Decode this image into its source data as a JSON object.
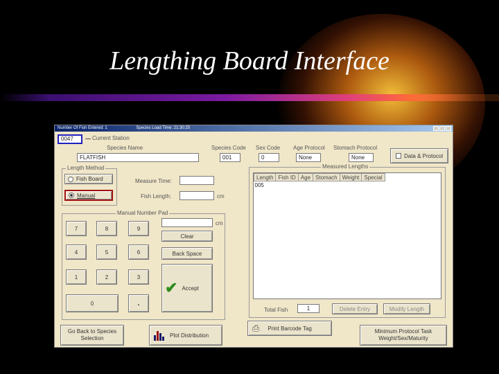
{
  "slide": {
    "title": "Lengthing Board Interface"
  },
  "window": {
    "title": "Number Of Fish Entered: 1",
    "load_time": "Species Load Time: 21:30:25"
  },
  "station": {
    "value": "0047",
    "label": "Current Station"
  },
  "species": {
    "name_label": "Species Name",
    "name_value": "FLATFISH",
    "code_label": "Species Code",
    "code_value": "001",
    "sex_label": "Sex Code",
    "sex_value": "0",
    "age_label": "Age Protocol",
    "age_value": "None",
    "stomach_label": "Stomach Protocol",
    "stomach_value": "None",
    "protocol_button": "Data & Protocol"
  },
  "length_method": {
    "group_label": "Length Method",
    "fish_board": "Fish Board",
    "manual": "Manual",
    "selected": "Manual",
    "measure_time_label": "Measure Time:",
    "fish_length_label": "Fish Length:",
    "unit": "cm"
  },
  "number_pad": {
    "group_label": "Manual Number Pad",
    "unit": "cm",
    "keys": [
      "7",
      "8",
      "9",
      "4",
      "5",
      "6",
      "1",
      "2",
      "3",
      "0",
      "."
    ],
    "clear": "Clear",
    "backspace": "Back Space",
    "accept": "Accept"
  },
  "lengths": {
    "group_label": "Measured Lengths",
    "columns": [
      "Length",
      "Fish ID",
      "Age",
      "Stomach",
      "Weight",
      "Special"
    ],
    "rows": [
      [
        "005"
      ]
    ],
    "total_label": "Total Fish",
    "total_value": "1",
    "delete_button": "Delete Entry",
    "modify_button": "Modify Length"
  },
  "bottom": {
    "back_button": "Go Back to Species Selection",
    "plot_button": "Plot Distribution",
    "print_button": "Print Barcode Tag",
    "minimum_button": "Minimum Protocol Task Weight/Sex/Maturity"
  },
  "colors": {
    "background": "#000000",
    "window": "#f0e6c8",
    "titlebar": "#0a246a",
    "accept_check": "#2e8b1e",
    "manual_highlight": "#a01010",
    "station_highlight": "#2020c0"
  }
}
